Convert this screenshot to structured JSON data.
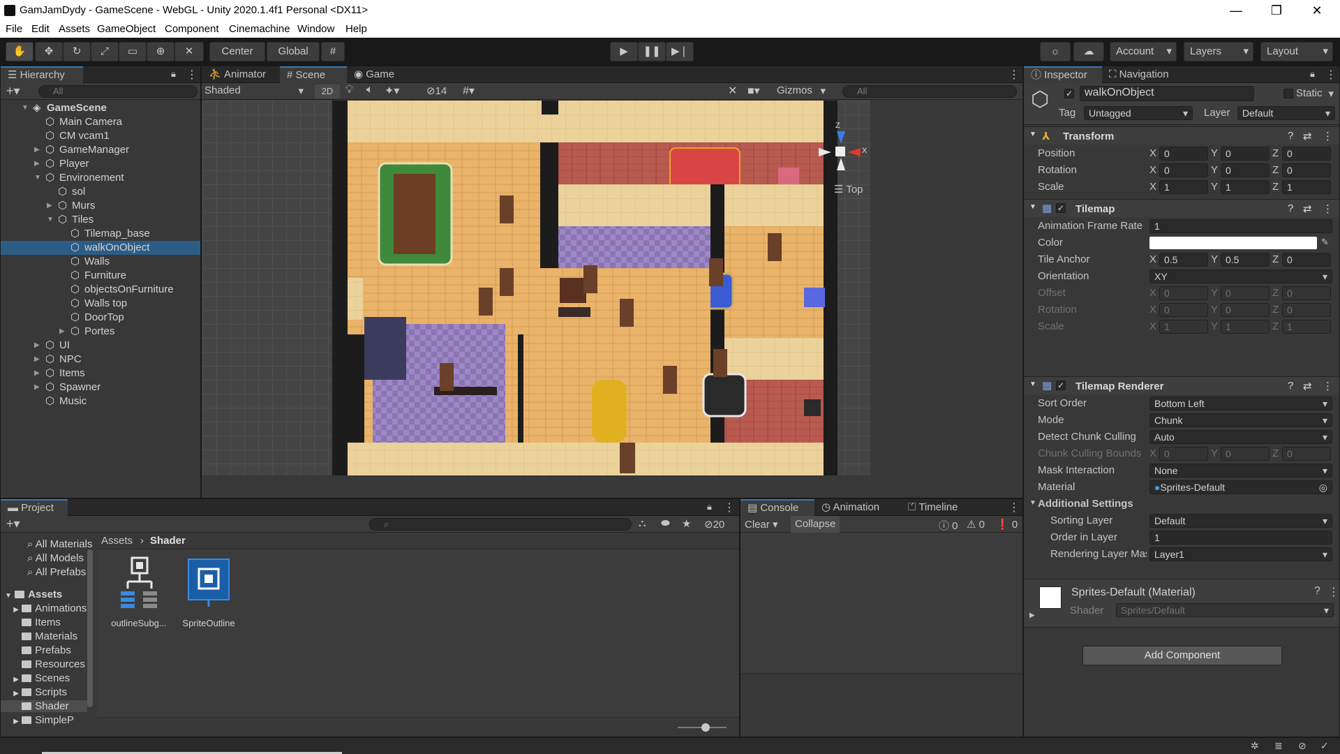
{
  "window": {
    "title": "GamJamDydy - GameScene - WebGL - Unity 2020.1.4f1 Personal <DX11>"
  },
  "menu": [
    "File",
    "Edit",
    "Assets",
    "GameObject",
    "Component",
    "Cinemachine",
    "Window",
    "Help"
  ],
  "toolbar": {
    "pivot": "Center",
    "space": "Global",
    "account": "Account",
    "layers": "Layers",
    "layout": "Layout"
  },
  "hierarchy": {
    "tab": "Hierarchy",
    "search_placeholder": "All",
    "items": [
      {
        "label": "GameScene",
        "depth": 0,
        "expanded": true,
        "root": true
      },
      {
        "label": "Main Camera",
        "depth": 1
      },
      {
        "label": "CM vcam1",
        "depth": 1
      },
      {
        "label": "GameManager",
        "depth": 1,
        "collapsed": true
      },
      {
        "label": "Player",
        "depth": 1,
        "collapsed": true
      },
      {
        "label": "Environement",
        "depth": 1,
        "expanded": true
      },
      {
        "label": "sol",
        "depth": 2
      },
      {
        "label": "Murs",
        "depth": 2,
        "collapsed": true
      },
      {
        "label": "Tiles",
        "depth": 2,
        "expanded": true
      },
      {
        "label": "Tilemap_base",
        "depth": 3
      },
      {
        "label": "walkOnObject",
        "depth": 3,
        "selected": true
      },
      {
        "label": "Walls",
        "depth": 3
      },
      {
        "label": "Furniture",
        "depth": 3
      },
      {
        "label": "objectsOnFurniture",
        "depth": 3
      },
      {
        "label": "Walls top",
        "depth": 3
      },
      {
        "label": "DoorTop",
        "depth": 3
      },
      {
        "label": "Portes",
        "depth": 3,
        "collapsed": true
      },
      {
        "label": "UI",
        "depth": 1,
        "collapsed": true
      },
      {
        "label": "NPC",
        "depth": 1,
        "collapsed": true
      },
      {
        "label": "Items",
        "depth": 1,
        "collapsed": true
      },
      {
        "label": "Spawner",
        "depth": 1,
        "collapsed": true
      },
      {
        "label": "Music",
        "depth": 1
      }
    ]
  },
  "scene": {
    "tabs": [
      "Animator",
      "Scene",
      "Game"
    ],
    "shading": "Shaded",
    "mode2d": "2D",
    "hidden_count": "14",
    "gizmos": "Gizmos",
    "search_placeholder": "All",
    "orientation": "Top",
    "gizmo_axes": {
      "z": "Z",
      "x": "X"
    }
  },
  "inspector": {
    "tabs": [
      "Inspector",
      "Navigation"
    ],
    "object_name": "walkOnObject",
    "static_label": "Static",
    "tag_label": "Tag",
    "tag": "Untagged",
    "layer_label": "Layer",
    "layer": "Default",
    "transform": {
      "title": "Transform",
      "rows": [
        {
          "label": "Position",
          "x": "0",
          "y": "0",
          "z": "0"
        },
        {
          "label": "Rotation",
          "x": "0",
          "y": "0",
          "z": "0"
        },
        {
          "label": "Scale",
          "x": "1",
          "y": "1",
          "z": "1"
        }
      ]
    },
    "tilemap": {
      "title": "Tilemap",
      "anim_label": "Animation Frame Rate",
      "anim_value": "1",
      "color_label": "Color",
      "anchor_label": "Tile Anchor",
      "anchor": {
        "x": "0.5",
        "y": "0.5",
        "z": "0"
      },
      "orientation_label": "Orientation",
      "orientation": "XY",
      "offset_label": "Offset",
      "offset": {
        "x": "0",
        "y": "0",
        "z": "0"
      },
      "rotation_label": "Rotation",
      "rotation": {
        "x": "0",
        "y": "0",
        "z": "0"
      },
      "scale_label": "Scale",
      "scale": {
        "x": "1",
        "y": "1",
        "z": "1"
      }
    },
    "renderer": {
      "title": "Tilemap Renderer",
      "sort_label": "Sort Order",
      "sort": "Bottom Left",
      "mode_label": "Mode",
      "mode": "Chunk",
      "detect_label": "Detect Chunk Culling",
      "detect": "Auto",
      "bounds_label": "Chunk Culling Bounds",
      "bounds": {
        "x": "0",
        "y": "0",
        "z": "0"
      },
      "mask_label": "Mask Interaction",
      "mask": "None",
      "material_label": "Material",
      "material": "Sprites-Default",
      "additional": "Additional Settings",
      "sorting_layer_label": "Sorting Layer",
      "sorting_layer": "Default",
      "order_label": "Order in Layer",
      "order": "1",
      "rendering_label": "Rendering Layer Mask",
      "rendering": "Layer1"
    },
    "material_box": {
      "title": "Sprites-Default (Material)",
      "shader_label": "Shader",
      "shader": "Sprites/Default"
    },
    "add_component": "Add Component"
  },
  "project": {
    "tab": "Project",
    "favorites": [
      "All Materials",
      "All Models",
      "All Prefabs"
    ],
    "assets_label": "Assets",
    "folders": [
      "Animations",
      "Items",
      "Materials",
      "Prefabs",
      "Resources",
      "Scenes",
      "Scripts",
      "Shader",
      "SimpleP"
    ],
    "breadcrumb": [
      "Assets",
      "Shader"
    ],
    "hidden_count": "20",
    "files": [
      {
        "name": "outlineSubg...",
        "icon": "shader-graph-icon"
      },
      {
        "name": "SpriteOutline",
        "icon": "shader-icon"
      }
    ]
  },
  "console": {
    "tabs": [
      "Console",
      "Animation",
      "Timeline"
    ],
    "clear": "Clear",
    "collapse": "Collapse",
    "logs": "0",
    "warnings": "0",
    "errors": "0"
  }
}
